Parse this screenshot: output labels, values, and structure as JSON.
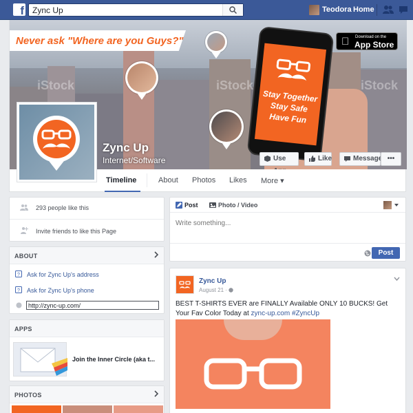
{
  "topbar": {
    "logo": "f",
    "search_value": "Zync Up",
    "search_placeholder": "Search",
    "user_name": "Teodora",
    "home_label": "Home"
  },
  "cover": {
    "tagline": "Never ask \"Where are you Guys?\" again!",
    "appstore_small": "Download on the",
    "appstore_big": "App Store",
    "phone_lines": [
      "Stay Together",
      "Stay Safe",
      "Have Fun"
    ],
    "watermark": "iStock",
    "brand_color": "#f26522"
  },
  "page": {
    "name": "Zync Up",
    "category": "Internet/Software",
    "buttons": {
      "use_app": "Use App",
      "like": "Like",
      "message": "Message",
      "more": "•••"
    },
    "tabs": [
      "Timeline",
      "About",
      "Photos",
      "Likes",
      "More ▾"
    ]
  },
  "left": {
    "likes_count_text": "293 people like this",
    "invite_text": "Invite friends to like this Page",
    "about_header": "ABOUT",
    "about_items": [
      "Ask for Zync Up's address",
      "Ask for Zync Up's phone"
    ],
    "website": "http://zync-up.com/",
    "apps_header": "APPS",
    "app_name": "Join the Inner Circle (aka t...",
    "photos_header": "PHOTOS"
  },
  "composer": {
    "tab_post": "Post",
    "tab_photo": "Photo / Video",
    "placeholder": "Write something...",
    "post_button": "Post"
  },
  "post": {
    "author": "Zync Up",
    "date": "August 21 ·",
    "text_main": "BEST T-SHIRTS EVER are FINALLY Available ONLY 10 BUCKS! Get Your Fav Color Today at",
    "link": "zync-up.com",
    "hashtag": "#ZyncUp"
  }
}
